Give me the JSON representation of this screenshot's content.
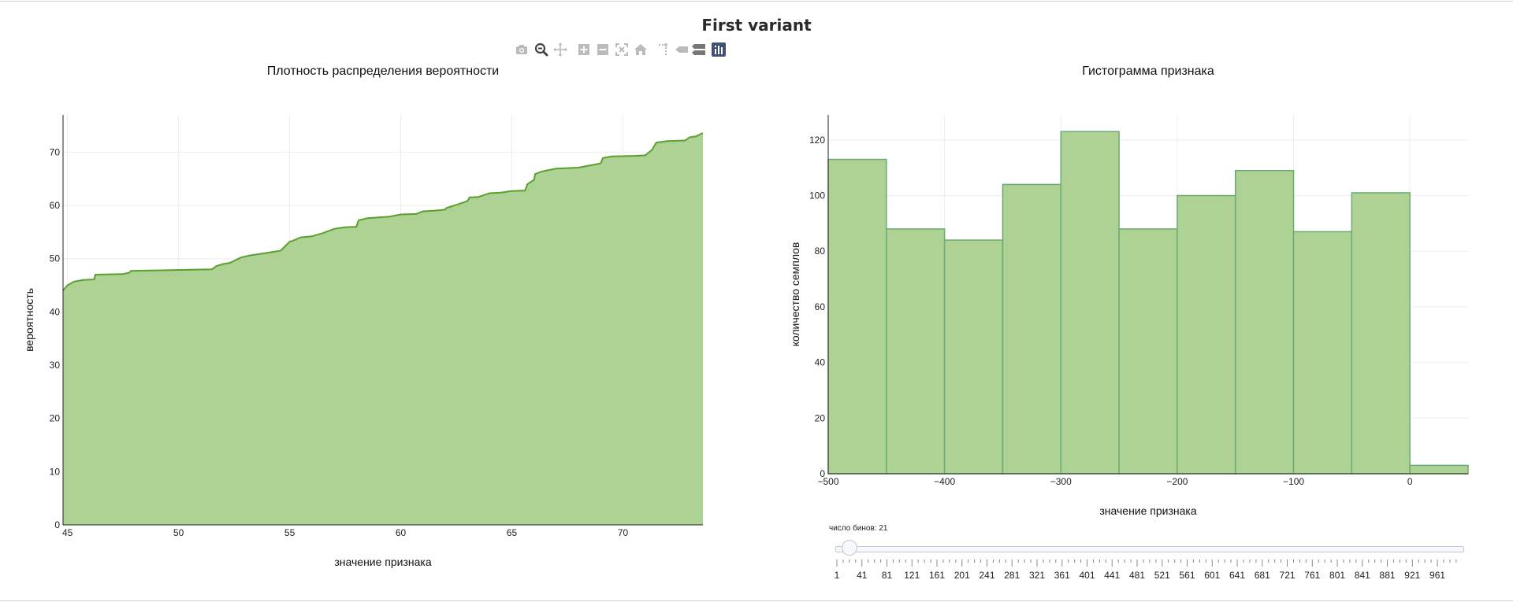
{
  "page": {
    "title": "First variant"
  },
  "modebar": {
    "icons": [
      "camera-icon",
      "zoom-icon",
      "pan-icon",
      "zoom-in-icon",
      "zoom-out-icon",
      "autoscale-icon",
      "reset-axes-icon",
      "spike-lines-icon",
      "hover-closest-icon",
      "hover-compare-icon",
      "plotly-logo-icon"
    ],
    "active_color": "#444444",
    "inactive_color": "#bbbbbb"
  },
  "colors": {
    "fill": "#aed294",
    "line": "#5aa02c",
    "bar_fill": "#aed294",
    "bar_line": "#6aaa74",
    "grid": "#eeeeee",
    "axis": "#222222"
  },
  "chart_data": [
    {
      "type": "area",
      "title": "Плотность распределения вероятности",
      "xlabel": "значение признака",
      "ylabel": "вероятность",
      "xlim": [
        44.8,
        73.6
      ],
      "ylim": [
        0,
        77
      ],
      "xticks": [
        45,
        50,
        55,
        60,
        65,
        70
      ],
      "yticks": [
        0,
        10,
        20,
        30,
        40,
        50,
        60,
        70
      ],
      "grid": true,
      "x": [
        44.8,
        45.0,
        45.3,
        45.7,
        46.2,
        46.25,
        47.5,
        47.8,
        47.85,
        49.0,
        51.5,
        51.7,
        52.0,
        52.3,
        52.5,
        52.8,
        53.2,
        54.0,
        54.3,
        54.6,
        55.0,
        55.1,
        55.5,
        56.0,
        56.5,
        57.0,
        57.5,
        58.0,
        58.1,
        58.5,
        59.5,
        60.0,
        60.7,
        61.0,
        61.5,
        62.0,
        62.05,
        62.5,
        63.0,
        63.1,
        63.5,
        64.0,
        64.5,
        65.0,
        65.6,
        65.7,
        66.0,
        66.05,
        66.3,
        66.5,
        67.0,
        68.0,
        69.0,
        69.1,
        69.5,
        70.5,
        71.0,
        71.3,
        71.5,
        72.0,
        72.8,
        73.0,
        73.3,
        73.6
      ],
      "y": [
        44.0,
        45.0,
        45.7,
        46.0,
        46.1,
        47.0,
        47.1,
        47.4,
        47.7,
        47.8,
        48.0,
        48.6,
        49.0,
        49.2,
        49.6,
        50.2,
        50.6,
        51.1,
        51.3,
        51.5,
        53.2,
        53.3,
        54.0,
        54.2,
        54.8,
        55.6,
        55.9,
        56.0,
        57.2,
        57.6,
        57.9,
        58.3,
        58.4,
        58.9,
        59.0,
        59.2,
        59.5,
        60.1,
        60.8,
        61.5,
        61.6,
        62.3,
        62.4,
        62.7,
        62.8,
        64.0,
        64.8,
        65.9,
        66.3,
        66.5,
        66.9,
        67.1,
        67.9,
        68.9,
        69.2,
        69.3,
        69.4,
        70.4,
        71.8,
        72.1,
        72.2,
        72.8,
        73.0,
        73.6
      ]
    },
    {
      "type": "bar",
      "title": "Гистограмма признака",
      "xlabel": "значение признака",
      "ylabel": "количество семплов",
      "xlim": [
        -500,
        50
      ],
      "ylim": [
        0,
        129
      ],
      "xticks": [
        -500,
        -400,
        -300,
        -200,
        -100,
        0
      ],
      "xtick_labels": [
        "−500",
        "−400",
        "−300",
        "−200",
        "−100",
        "0"
      ],
      "yticks": [
        0,
        20,
        40,
        60,
        80,
        100,
        120
      ],
      "grid": true,
      "bins": [
        [
          -500,
          -450
        ],
        [
          -450,
          -400
        ],
        [
          -400,
          -350
        ],
        [
          -350,
          -300
        ],
        [
          -300,
          -250
        ],
        [
          -250,
          -200
        ],
        [
          -200,
          -150
        ],
        [
          -150,
          -100
        ],
        [
          -100,
          -50
        ],
        [
          -50,
          0
        ],
        [
          0,
          50
        ]
      ],
      "values": [
        113,
        88,
        84,
        104,
        123,
        88,
        100,
        109,
        87,
        101,
        3
      ]
    }
  ],
  "slider": {
    "label": "число бинов: 21",
    "min": 1,
    "max": 1000,
    "value": 21,
    "step_labels": [
      "1",
      "41",
      "81",
      "121",
      "161",
      "201",
      "241",
      "281",
      "321",
      "361",
      "401",
      "441",
      "481",
      "521",
      "561",
      "601",
      "641",
      "681",
      "721",
      "761",
      "801",
      "841",
      "881",
      "921",
      "961"
    ]
  }
}
